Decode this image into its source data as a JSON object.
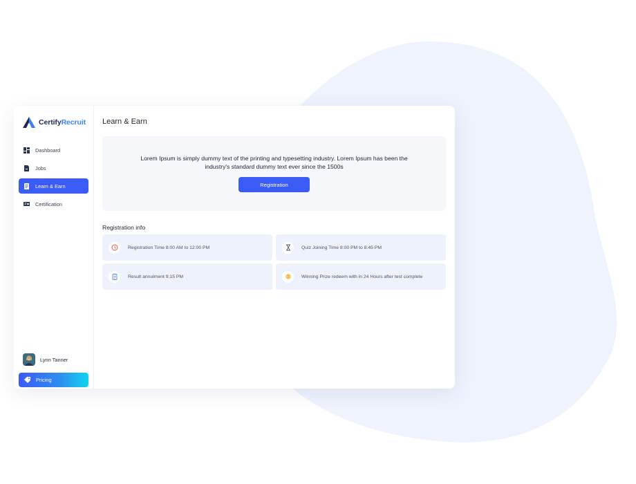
{
  "brand": {
    "name_part1": "Certify",
    "name_part2": "Recruit",
    "color_dark": "#1d2a56",
    "color_accent": "#3b82f6"
  },
  "sidebar": {
    "items": [
      {
        "label": "Dashboard",
        "icon": "dashboard-icon",
        "active": false
      },
      {
        "label": "Jobs",
        "icon": "jobs-icon",
        "active": false
      },
      {
        "label": "Learn & Earn",
        "icon": "learn-icon",
        "active": true
      },
      {
        "label": "Certification",
        "icon": "certificate-icon",
        "active": false
      }
    ],
    "user": {
      "name": "Lynn Tanner"
    },
    "pricing_label": "Pricing"
  },
  "main": {
    "title": "Learn & Earn",
    "hero": {
      "text": "Lorem Ipsum is simply dummy text of the printing and typesetting industry. Lorem Ipsum has been the industry's standard dummy text ever since the 1500s",
      "button_label": "Registration"
    },
    "registration": {
      "title": "Registration info",
      "items": [
        {
          "text": "Registration Time 8:00 AM to 12:00 PM",
          "icon": "clock-icon"
        },
        {
          "text": "Quiz Joining Time 8:00 PM to 8:45 PM",
          "icon": "hourglass-icon"
        },
        {
          "text": "Result annulment 9:15 PM",
          "icon": "clipboard-icon"
        },
        {
          "text": "Winning Prize redeem  with in 24 Hours after test complete",
          "icon": "prize-icon"
        }
      ]
    }
  },
  "colors": {
    "accent": "#3b5bf5",
    "card_bg": "#eef2fd",
    "blob": "#eef3fe"
  }
}
